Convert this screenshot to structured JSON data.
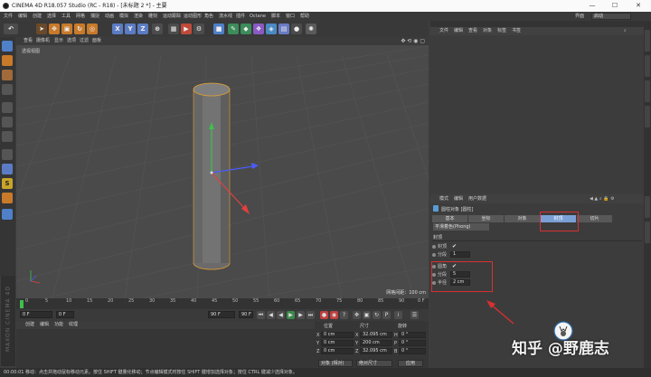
{
  "window": {
    "title": "CINEMA 4D R18.057 Studio (RC - R18) - [未标题 2 *] - 主要",
    "controls": [
      "—",
      "☐",
      "✕"
    ]
  },
  "menubar": {
    "items": [
      "文件",
      "编辑",
      "创建",
      "选择",
      "工具",
      "网格",
      "捕捉",
      "动画",
      "模拟",
      "渲染",
      "雕刻",
      "运动跟踪",
      "运动图形",
      "角色",
      "流水线",
      "插件",
      "Octane",
      "脚本",
      "窗口",
      "帮助"
    ],
    "layout_label": "界面",
    "layout_value": "启动"
  },
  "toolbar": {
    "axis_buttons": [
      "X",
      "Y",
      "Z"
    ]
  },
  "viewport": {
    "menu": [
      "查看",
      "摄像机",
      "显示",
      "选项",
      "过滤",
      "面板"
    ],
    "label": "透视视图",
    "grid_spacing": "网格间距：100 cm"
  },
  "timeline": {
    "ticks": [
      "0",
      "5",
      "10",
      "15",
      "20",
      "25",
      "30",
      "35",
      "40",
      "45",
      "50",
      "55",
      "60",
      "65",
      "70",
      "75",
      "80",
      "85",
      "90"
    ],
    "current_frame": "0 F",
    "start_frame": "0 F",
    "end_frame": "90 F",
    "max_frame": "90 F",
    "end_marker": "0 F"
  },
  "transport": {
    "buttons": [
      "⏮",
      "◀",
      "◀",
      "▶",
      "▶",
      "⏭"
    ]
  },
  "materials": {
    "menu": [
      "创建",
      "编辑",
      "功能",
      "纹理"
    ]
  },
  "coordinates": {
    "headers": [
      "位置",
      "尺寸",
      "旋转"
    ],
    "rows": [
      {
        "pos_axis": "X",
        "pos": "0 cm",
        "size_axis": "X",
        "size": "32.095 cm",
        "rot_axis": "H",
        "rot": "0 °"
      },
      {
        "pos_axis": "Y",
        "pos": "0 cm",
        "size_axis": "Y",
        "size": "200 cm",
        "rot_axis": "P",
        "rot": "0 °"
      },
      {
        "pos_axis": "Z",
        "pos": "0 cm",
        "size_axis": "Z",
        "size": "32.095 cm",
        "rot_axis": "B",
        "rot": "0 °"
      }
    ],
    "mode_select": "对象 (相对)",
    "size_select": "绝对尺寸",
    "apply_button": "应用"
  },
  "object_manager": {
    "menu": [
      "文件",
      "编辑",
      "查看",
      "对象",
      "标签",
      "书签"
    ]
  },
  "attributes": {
    "menu": [
      "模式",
      "编辑",
      "用户数据"
    ],
    "object_title": "圆柱对象 [圆柱]",
    "tabs": [
      "基本",
      "坐标",
      "对象",
      "封顶",
      "切片"
    ],
    "active_tab": "封顶",
    "phong_tab": "平滑着色(Phong)",
    "section_title": "封顶",
    "params": [
      {
        "label": "封顶",
        "value": "✔"
      },
      {
        "label": "分段",
        "value": "1"
      },
      {
        "label": "圆角",
        "value": "✔"
      },
      {
        "label": "分段",
        "value": "5"
      },
      {
        "label": "半径",
        "value": "2 cm"
      }
    ]
  },
  "statusbar": {
    "text": "00:00:01   移动：点击并拖动鼠标移动元素。按住 SHIFT 键量化移动；节点编辑模式时按住 SHIFT 键增加选择对象；按住 CTRL 键减少选择对象。"
  },
  "watermark": {
    "text": "知乎 @野鹿志"
  },
  "colors": {
    "annotation_red": "#d93030",
    "active_tab_blue": "#7aa0d6",
    "axis_y_green": "#3fbf4f",
    "axis_x_red": "#e04040",
    "axis_z_blue": "#4a5cff",
    "selection_orange": "#e8a030"
  }
}
